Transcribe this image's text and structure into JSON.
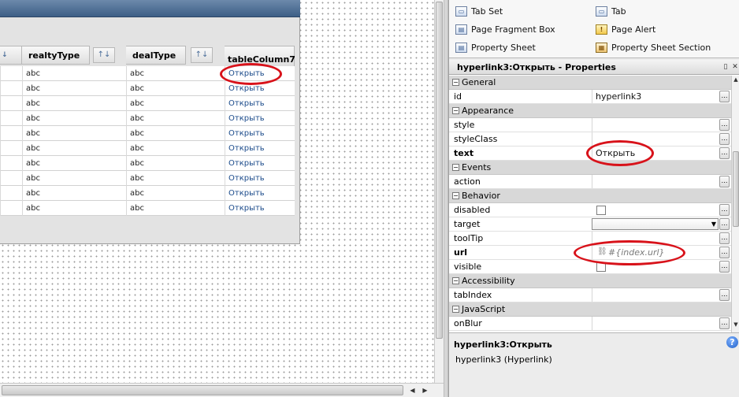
{
  "designer": {
    "table": {
      "headers": [
        {
          "key": "realtyType",
          "label": "realtyType"
        },
        {
          "key": "dealType",
          "label": "dealType"
        },
        {
          "key": "tableColumn7",
          "label": "tableColumn7"
        }
      ],
      "sort_symbol": "↑↓",
      "rows": [
        {
          "realtyType": "abc",
          "dealType": "abc",
          "link": "Открыть"
        },
        {
          "realtyType": "abc",
          "dealType": "abc",
          "link": "Открыть"
        },
        {
          "realtyType": "abc",
          "dealType": "abc",
          "link": "Открыть"
        },
        {
          "realtyType": "abc",
          "dealType": "abc",
          "link": "Открыть"
        },
        {
          "realtyType": "abc",
          "dealType": "abc",
          "link": "Открыть"
        },
        {
          "realtyType": "abc",
          "dealType": "abc",
          "link": "Открыть"
        },
        {
          "realtyType": "abc",
          "dealType": "abc",
          "link": "Открыть"
        },
        {
          "realtyType": "abc",
          "dealType": "abc",
          "link": "Открыть"
        },
        {
          "realtyType": "abc",
          "dealType": "abc",
          "link": "Открыть"
        },
        {
          "realtyType": "abc",
          "dealType": "abc",
          "link": "Открыть"
        }
      ]
    }
  },
  "palette": {
    "items": [
      {
        "label": "Tab Set",
        "icon": "tab-set-icon"
      },
      {
        "label": "Tab",
        "icon": "tab-icon"
      },
      {
        "label": "Page Fragment Box",
        "icon": "page-fragment-box-icon"
      },
      {
        "label": "Page Alert",
        "icon": "page-alert-icon"
      },
      {
        "label": "Property Sheet",
        "icon": "property-sheet-icon"
      },
      {
        "label": "Property Sheet Section",
        "icon": "property-sheet-section-icon"
      }
    ]
  },
  "properties": {
    "title": "hyperlink3:Открыть - Properties",
    "rows": [
      {
        "type": "category",
        "name": "General"
      },
      {
        "type": "prop",
        "name": "id",
        "value": "hyperlink3",
        "bold": false,
        "editor": "text"
      },
      {
        "type": "category",
        "name": "Appearance"
      },
      {
        "type": "prop",
        "name": "style",
        "value": "",
        "bold": false,
        "editor": "text"
      },
      {
        "type": "prop",
        "name": "styleClass",
        "value": "",
        "bold": false,
        "editor": "text"
      },
      {
        "type": "prop",
        "name": "text",
        "value": "Открыть",
        "bold": true,
        "editor": "text"
      },
      {
        "type": "category",
        "name": "Events"
      },
      {
        "type": "prop",
        "name": "action",
        "value": "",
        "bold": false,
        "editor": "text"
      },
      {
        "type": "category",
        "name": "Behavior"
      },
      {
        "type": "prop",
        "name": "disabled",
        "value": "",
        "bold": false,
        "editor": "checkbox"
      },
      {
        "type": "prop",
        "name": "target",
        "value": "",
        "bold": false,
        "editor": "dropdown"
      },
      {
        "type": "prop",
        "name": "toolTip",
        "value": "",
        "bold": false,
        "editor": "text"
      },
      {
        "type": "prop",
        "name": "url",
        "value": "#{index.url}",
        "bold": true,
        "editor": "binding"
      },
      {
        "type": "prop",
        "name": "visible",
        "value": "",
        "bold": false,
        "editor": "checkbox"
      },
      {
        "type": "category",
        "name": "Accessibility"
      },
      {
        "type": "prop",
        "name": "tabIndex",
        "value": "",
        "bold": false,
        "editor": "text"
      },
      {
        "type": "category",
        "name": "JavaScript"
      },
      {
        "type": "prop",
        "name": "onBlur",
        "value": "",
        "bold": false,
        "editor": "text"
      }
    ]
  },
  "description": {
    "title": "hyperlink3:Открыть",
    "text": "hyperlink3 (Hyperlink)"
  },
  "colors": {
    "highlight_ellipse": "#d8121a",
    "link": "#1a4a8a"
  }
}
